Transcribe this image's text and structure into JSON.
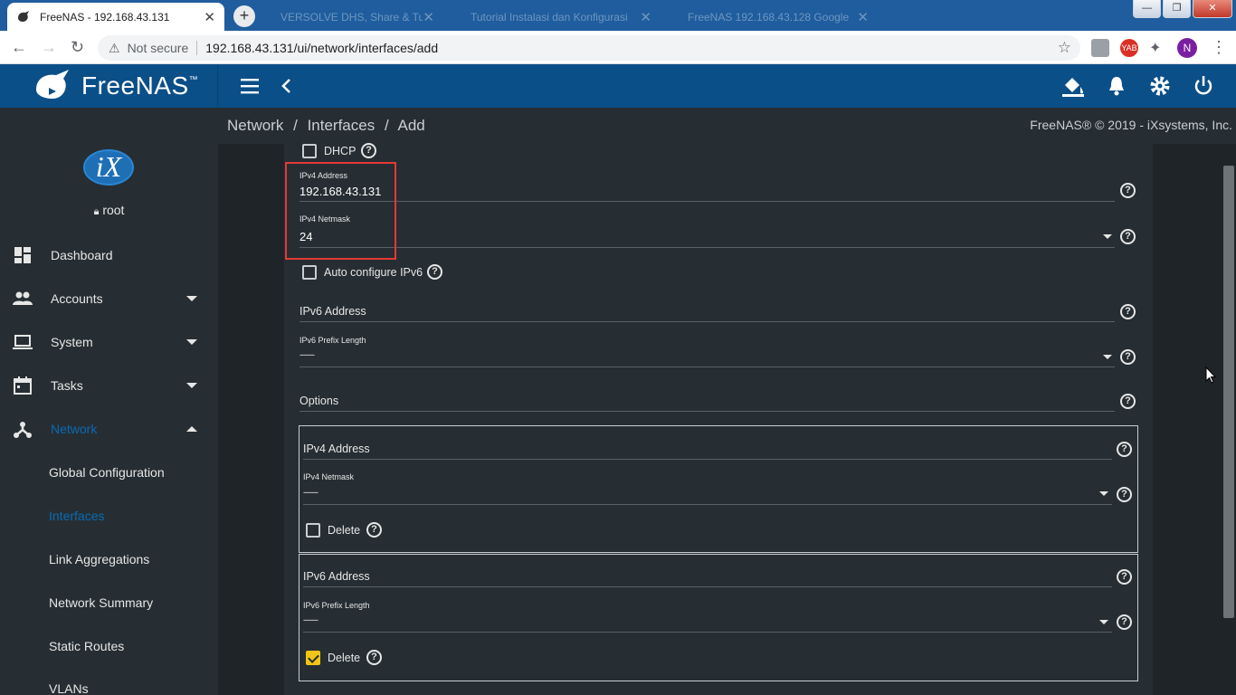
{
  "browser": {
    "active_tab_title": "FreeNAS - 192.168.43.131",
    "bg_tabs": [
      "VERSOLVE DHS, Share & Tu",
      "Tutorial Instalasi dan Konfigurasi",
      "FreeNAS 192.168.43.128 Google"
    ],
    "security_label": "Not secure",
    "url": "192.168.43.131/ui/network/interfaces/add",
    "profile_initial": "N",
    "ext_badge": "YAB"
  },
  "header": {
    "brand": "FreeNAS",
    "trademark": "™"
  },
  "sidebar": {
    "avatar_text": "iX",
    "user": "root",
    "items": [
      {
        "label": "Dashboard"
      },
      {
        "label": "Accounts"
      },
      {
        "label": "System"
      },
      {
        "label": "Tasks"
      },
      {
        "label": "Network"
      }
    ],
    "sub_items": [
      {
        "label": "Global Configuration"
      },
      {
        "label": "Interfaces"
      },
      {
        "label": "Link Aggregations"
      },
      {
        "label": "Network Summary"
      },
      {
        "label": "Static Routes"
      },
      {
        "label": "VLANs"
      }
    ]
  },
  "breadcrumb": {
    "parts": [
      "Network",
      "Interfaces",
      "Add"
    ],
    "separator": "/"
  },
  "copyright": "FreeNAS® © 2019 - iXsystems, Inc.",
  "form": {
    "dhcp_label": "DHCP",
    "ipv4_address_label": "IPv4 Address",
    "ipv4_address_value": "192.168.43.131",
    "ipv4_netmask_label": "IPv4 Netmask",
    "ipv4_netmask_value": "24",
    "auto_ipv6_label": "Auto configure IPv6",
    "ipv6_address_label": "IPv6 Address",
    "ipv6_prefix_label": "IPv6 Prefix Length",
    "ipv6_prefix_value": "--------",
    "options_label": "Options",
    "alias_ipv4": {
      "address_label": "IPv4 Address",
      "netmask_label": "IPv4 Netmask",
      "netmask_value": "--------",
      "delete_label": "Delete",
      "delete_checked": false
    },
    "alias_ipv6": {
      "address_label": "IPv6 Address",
      "prefix_label": "IPv6 Prefix Length",
      "prefix_value": "--------",
      "delete_label": "Delete",
      "delete_checked": true
    },
    "help_glyph": "?"
  },
  "colors": {
    "header": "#0b4f88",
    "sidebar": "#262e33",
    "active_nav": "#0a6ab4",
    "checkbox_checked": "#f0c516",
    "highlight": "#e53935"
  }
}
